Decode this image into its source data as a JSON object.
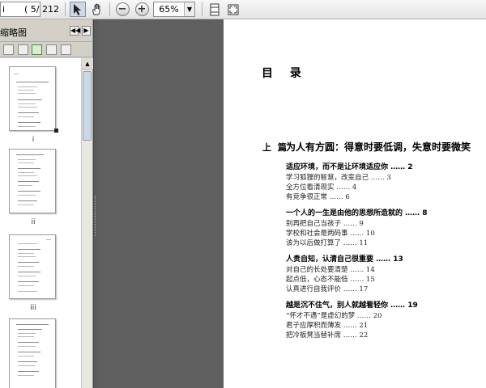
{
  "toolbar": {
    "page_field": "i",
    "page_total": "( 5/ 212 )",
    "zoom_out_symbol": "−",
    "zoom_in_symbol": "+",
    "zoom_value": "65%",
    "zoom_arrow": "▼",
    "icons": [
      "select-tool-icon",
      "hand-tool-icon",
      "zoom-out-icon",
      "zoom-in-icon",
      "fit-page-icon",
      "fullscreen-icon"
    ]
  },
  "sidebar": {
    "title": "缩略图",
    "nav_prev": "◀◀",
    "nav_next": "▶",
    "scroll_up": "▲",
    "thumbnails": [
      {
        "label": "i"
      },
      {
        "label": "ii"
      },
      {
        "label": "iii"
      },
      {
        "label": ""
      }
    ]
  },
  "document": {
    "toc_heading": "目 录",
    "part_label": "上 篇",
    "part_title": "为人有方圆：得意时要低调，失意时要微笑",
    "sections": [
      {
        "title": "适应环境，而不是让环境适应你 …… 2",
        "items": [
          "学习狐狸的智慧，改变自己 …… 3",
          "全方位看清现实 …… 4",
          "有竞争很正常 …… 6"
        ]
      },
      {
        "title": "一个人的一生是由他的思想所造就的 …… 8",
        "items": [
          "别再把自己当孩子 …… 9",
          "学校和社会是两码事 …… 10",
          "该为以后做打算了 …… 11"
        ]
      },
      {
        "title": "人贵自知，认清自己很重要 …… 13",
        "items": [
          "对自己的长处要清楚 …… 14",
          "起点低，心态不能低 …… 15",
          "认真进行自我评价 …… 17"
        ]
      },
      {
        "title": "越是沉不住气，别人就越看轻你 …… 19",
        "items": [
          "“怀才不遇”是虚幻的梦 …… 20",
          "君子应厚积而薄发 …… 21",
          "把冷板凳当替补席 …… 22"
        ]
      }
    ]
  }
}
